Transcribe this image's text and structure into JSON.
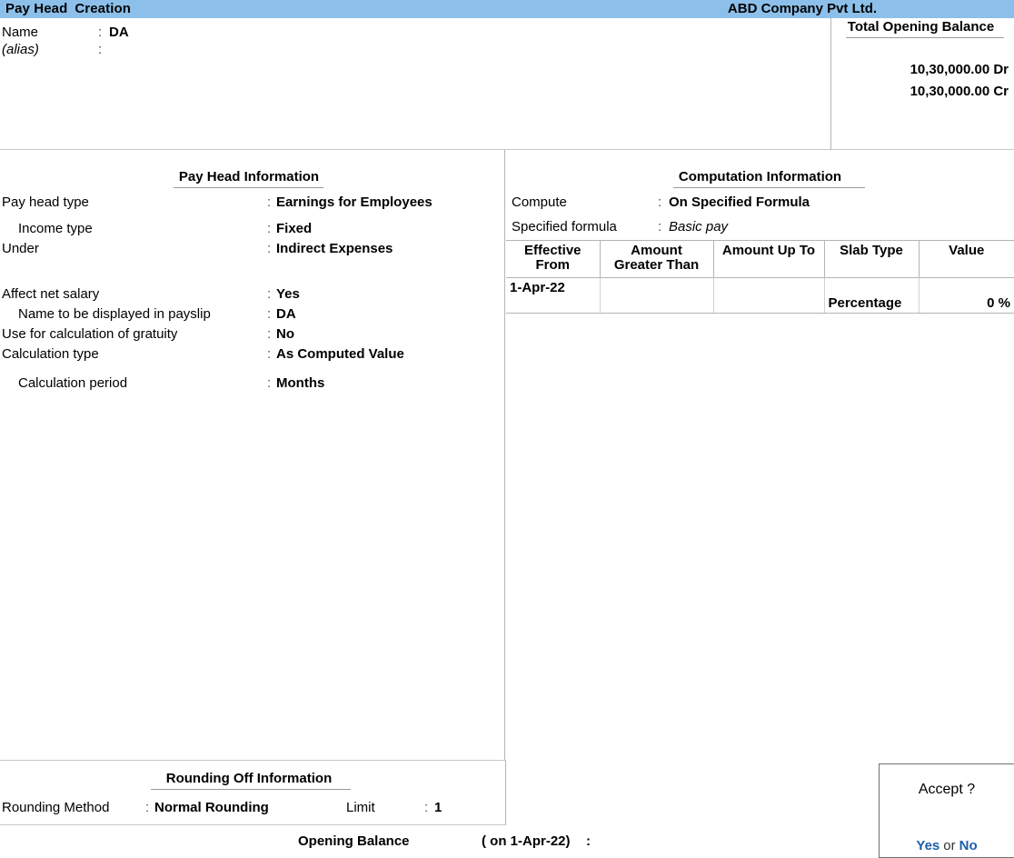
{
  "titlebar": {
    "screen_word1": "Pay Head",
    "screen_word2": "Creation",
    "company": "ABD Company Pvt Ltd."
  },
  "header": {
    "name_label": "Name",
    "name_colon": ":",
    "name_value": "DA",
    "alias_label": "(alias)",
    "alias_colon": ":",
    "alias_value": ""
  },
  "total_opening_balance": {
    "title": "Total Opening Balance",
    "debit": "10,30,000.00 Dr",
    "credit": "10,30,000.00 Cr"
  },
  "pay_head_information": {
    "title": "Pay Head Information",
    "rows": [
      {
        "label": "Pay head type",
        "colon": ":",
        "value": "Earnings for Employees"
      },
      {
        "label": "Income type",
        "colon": ":",
        "value": "Fixed"
      },
      {
        "label": "Under",
        "colon": ":",
        "value": "Indirect Expenses"
      },
      {
        "label": "Affect net salary",
        "colon": ":",
        "value": "Yes"
      },
      {
        "label": "Name to be displayed in payslip",
        "colon": ":",
        "value": "DA"
      },
      {
        "label": "Use for calculation of gratuity",
        "colon": ":",
        "value": "No"
      },
      {
        "label": "Calculation type",
        "colon": ":",
        "value": "As Computed Value"
      },
      {
        "label": "Calculation period",
        "colon": ":",
        "value": "Months"
      }
    ]
  },
  "computation_information": {
    "title": "Computation Information",
    "rows": [
      {
        "label": "Compute",
        "colon": ":",
        "value": "On Specified Formula"
      },
      {
        "label": "Specified formula",
        "colon": ":",
        "value": "Basic pay"
      }
    ],
    "table": {
      "columns": [
        "Effective From",
        "Amount Greater Than",
        "Amount Up To",
        "Slab Type",
        "Value"
      ],
      "columns_wrapped": [
        [
          "Effective",
          "From"
        ],
        [
          "Amount",
          "Greater Than"
        ],
        [
          "Amount Up To",
          ""
        ],
        [
          "Slab Type",
          ""
        ],
        [
          "Value",
          ""
        ]
      ],
      "rows": [
        {
          "effective_from": "1-Apr-22",
          "amount_greater_than": "",
          "amount_up_to": "",
          "slab_type": "Percentage",
          "value": "0 %"
        }
      ]
    }
  },
  "rounding_off_information": {
    "title": "Rounding Off Information",
    "method_label": "Rounding Method",
    "method_colon": ":",
    "method_value": "Normal Rounding",
    "limit_label": "Limit",
    "limit_colon": ":",
    "limit_value": "1"
  },
  "footer": {
    "opening_balance_label": "Opening Balance",
    "opening_balance_date": "( on 1-Apr-22)",
    "opening_balance_colon": ":",
    "opening_balance_value": ""
  },
  "accept_dialog": {
    "title": "Accept ?",
    "yes": "Yes",
    "or": "or",
    "no": "No"
  },
  "colors": {
    "titlebar_bg": "#8cc0ea",
    "link_blue": "#1b5fa8",
    "border_gray": "#b4b4b4"
  }
}
